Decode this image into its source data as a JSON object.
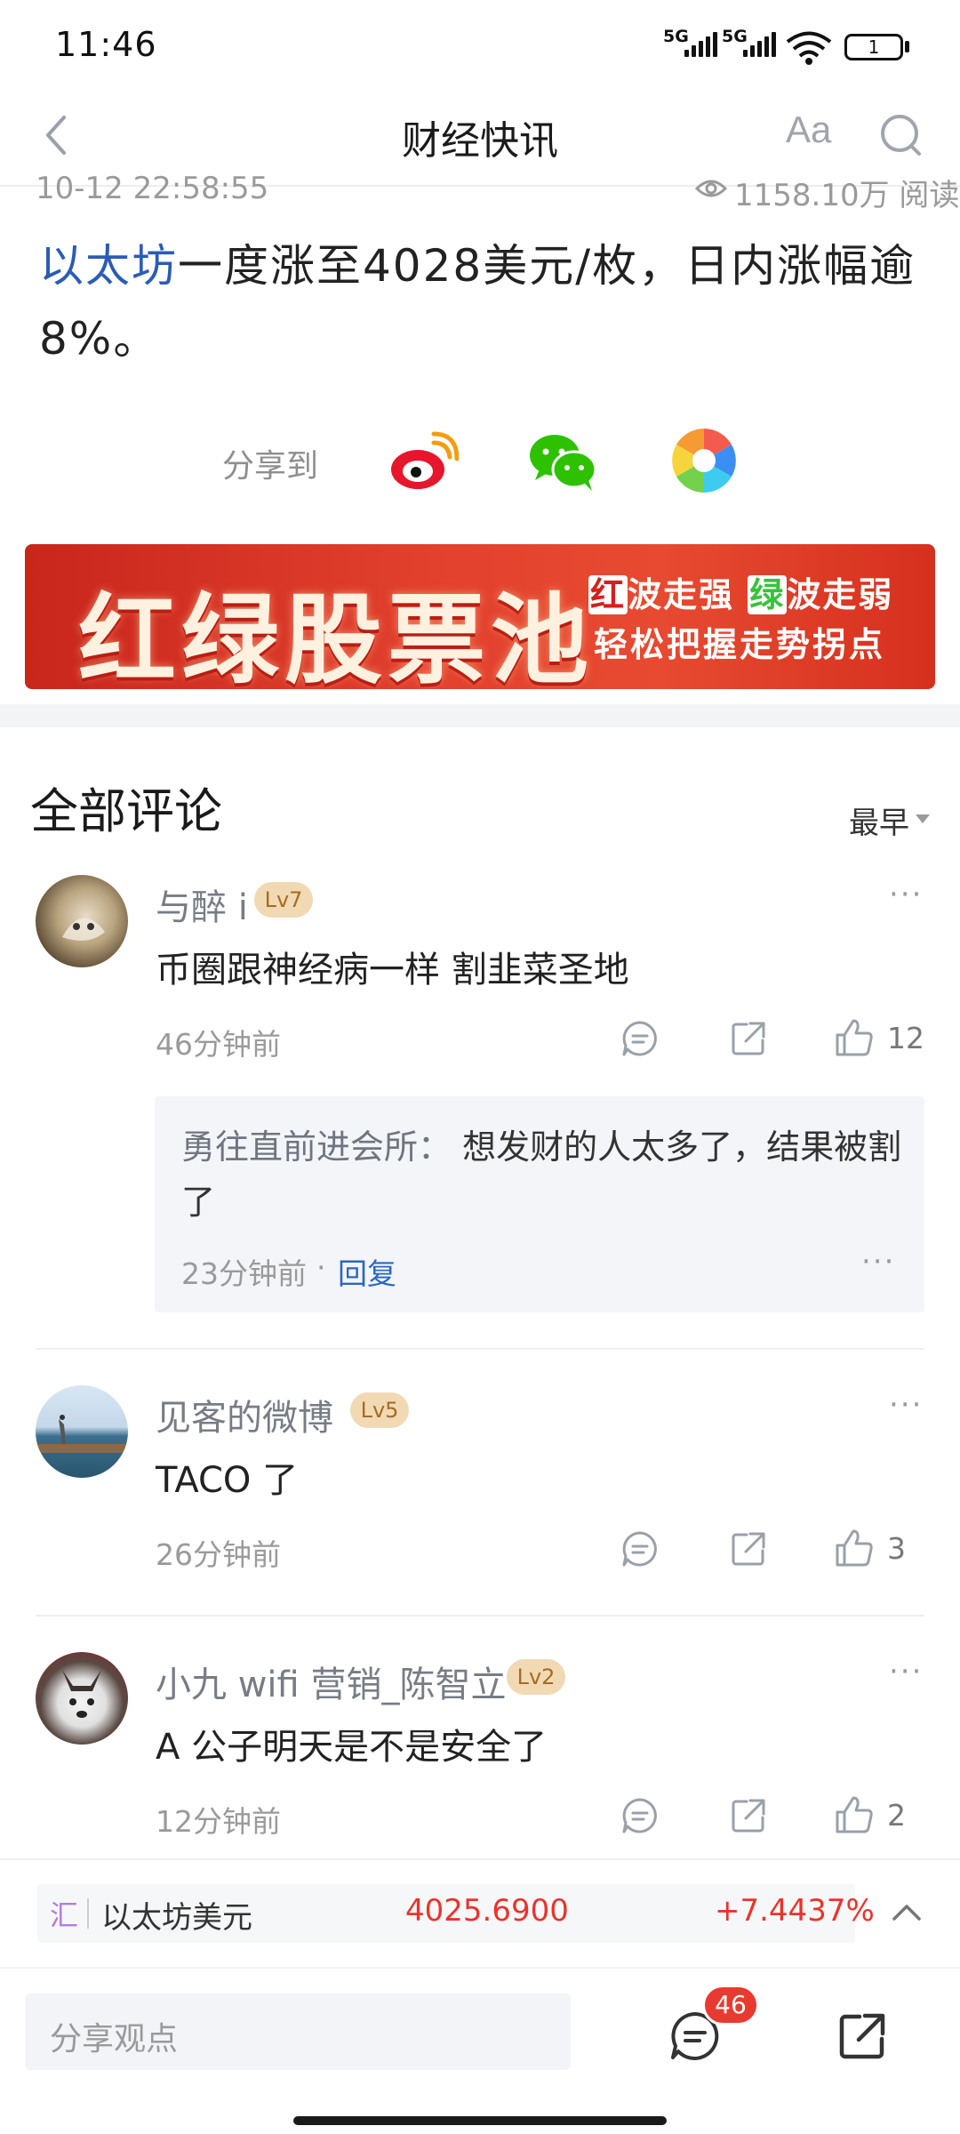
{
  "status_bar": {
    "time": "11:46",
    "signal1_label": "5G",
    "signal2_label": "5G",
    "battery": "1"
  },
  "nav": {
    "title": "财经快讯",
    "font_button": "Aa"
  },
  "article": {
    "time": "10-12 22:58:55",
    "reads": "1158.10万 阅读",
    "keyword": "以太坊",
    "body_rest": "一度涨至4028美元/枚，日内涨幅逾8%。"
  },
  "share": {
    "label": "分享到"
  },
  "banner": {
    "title": "红绿股票池",
    "line1_red": "红",
    "line1_mid": "波走强",
    "line1_green": "绿",
    "line1_end": "波走弱",
    "line2": "轻松把握走势拐点"
  },
  "comments": {
    "title": "全部评论",
    "sort": "最早",
    "more": "···",
    "items": [
      {
        "name": "与醉 i",
        "level": "Lv7",
        "text": "币圈跟神经病一样 割韭菜圣地",
        "time": "46分钟前",
        "likes": "12"
      },
      {
        "name": "见客的微博",
        "level": "Lv5",
        "text": "TACO 了",
        "time": "26分钟前",
        "likes": "3"
      },
      {
        "name": "小九 wifi 营销_陈智立",
        "level": "Lv2",
        "text": "A 公子明天是不是安全了",
        "time": "12分钟前",
        "likes": "2"
      }
    ],
    "reply": {
      "author": "勇往直前进会所：",
      "text": " 想发财的人太多了，结果被割了",
      "time": "23分钟前",
      "dot": "·",
      "link": "回复"
    }
  },
  "ticker": {
    "tag": "汇",
    "name": "以太坊美元",
    "price": "4025.6900",
    "change": "+7.4437%"
  },
  "bottom": {
    "placeholder": "分享观点",
    "comment_count": "46"
  },
  "colors": {
    "accent_blue": "#2b5cb5",
    "up_red": "#e8342b",
    "banner_red": "#d6301f",
    "level_gold": "#f1d9b3"
  }
}
